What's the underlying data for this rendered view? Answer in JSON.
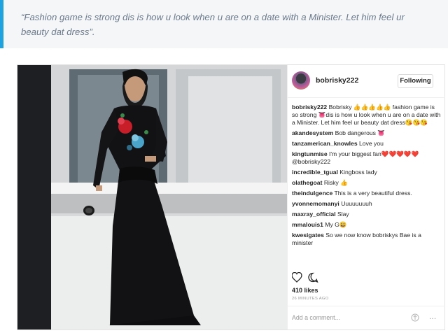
{
  "quote": {
    "text": "“Fashion game is strong dis is how u look when u are on a date with a Minister. Let him feel ur beauty dat dress”."
  },
  "post": {
    "username": "bobrisky222",
    "follow_label": "Following",
    "caption_user": "bobrisky222",
    "caption_text": "Bobrisky 👍👍👍👍👍 fashion game is so strong 👅dis is how u look when u are on a date with a Minister. Let him feel ur beauty dat dress😘😘😘",
    "comments": [
      {
        "user": "akandesystem",
        "text": "Bob dangerous 👅"
      },
      {
        "user": "tanzamerican_knowles",
        "text": "Love you"
      },
      {
        "user": "kingtunmise",
        "text": "I'm your biggest fan❤️❤️❤️❤️❤️ @bobrisky222"
      },
      {
        "user": "incredible_tgual",
        "text": "Kingboss lady"
      },
      {
        "user": "olathegoat",
        "text": "Risky 👍"
      },
      {
        "user": "theindulgence",
        "text": "This is a very beautiful dress."
      },
      {
        "user": "yvonnemomanyi",
        "text": "Uuuuuuuuh"
      },
      {
        "user": "maxray_official",
        "text": "Slay"
      },
      {
        "user": "mmalouis1",
        "text": "My G😃"
      },
      {
        "user": "kwesigates",
        "text": "So we now know bobriskys Bae is a minister"
      }
    ],
    "likes": "410 likes",
    "time": "26 MINUTES AGO",
    "add_comment_placeholder": "Add a comment...",
    "more_glyph": "…"
  },
  "colors": {
    "accent": "#1ea3e0",
    "quote_bg": "#f5f6f8",
    "quote_text": "#6b7a8a"
  },
  "icons": [
    "heart-icon",
    "comment-icon",
    "upload-icon",
    "more-icon"
  ]
}
